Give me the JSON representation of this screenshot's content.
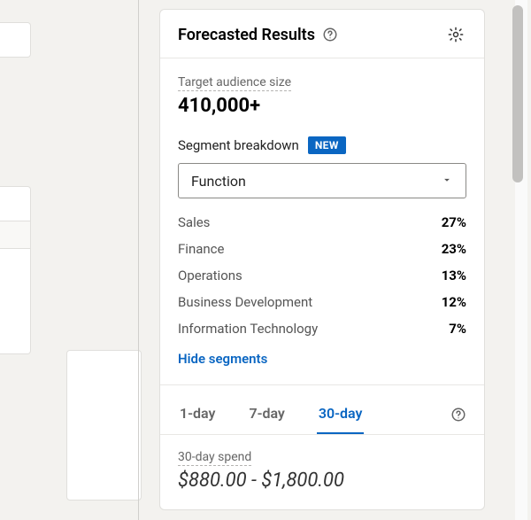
{
  "panel": {
    "title": "Forecasted Results",
    "audience": {
      "label": "Target audience size",
      "value": "410,000+"
    },
    "segment": {
      "label": "Segment breakdown",
      "badge": "NEW",
      "select_value": "Function",
      "items": [
        {
          "name": "Sales",
          "pct": "27%"
        },
        {
          "name": "Finance",
          "pct": "23%"
        },
        {
          "name": "Operations",
          "pct": "13%"
        },
        {
          "name": "Business Development",
          "pct": "12%"
        },
        {
          "name": "Information Technology",
          "pct": "7%"
        }
      ],
      "hide_label": "Hide segments"
    },
    "tabs": {
      "t1": "1-day",
      "t7": "7-day",
      "t30": "30-day",
      "active": "30-day"
    },
    "spend": {
      "label": "30-day spend",
      "value": "$880.00 - $1,800.00"
    }
  },
  "colors": {
    "accent": "#0a66c2"
  },
  "icons": {
    "help": "help-icon",
    "gear": "gear-icon",
    "caret": "chevron-down-icon"
  }
}
